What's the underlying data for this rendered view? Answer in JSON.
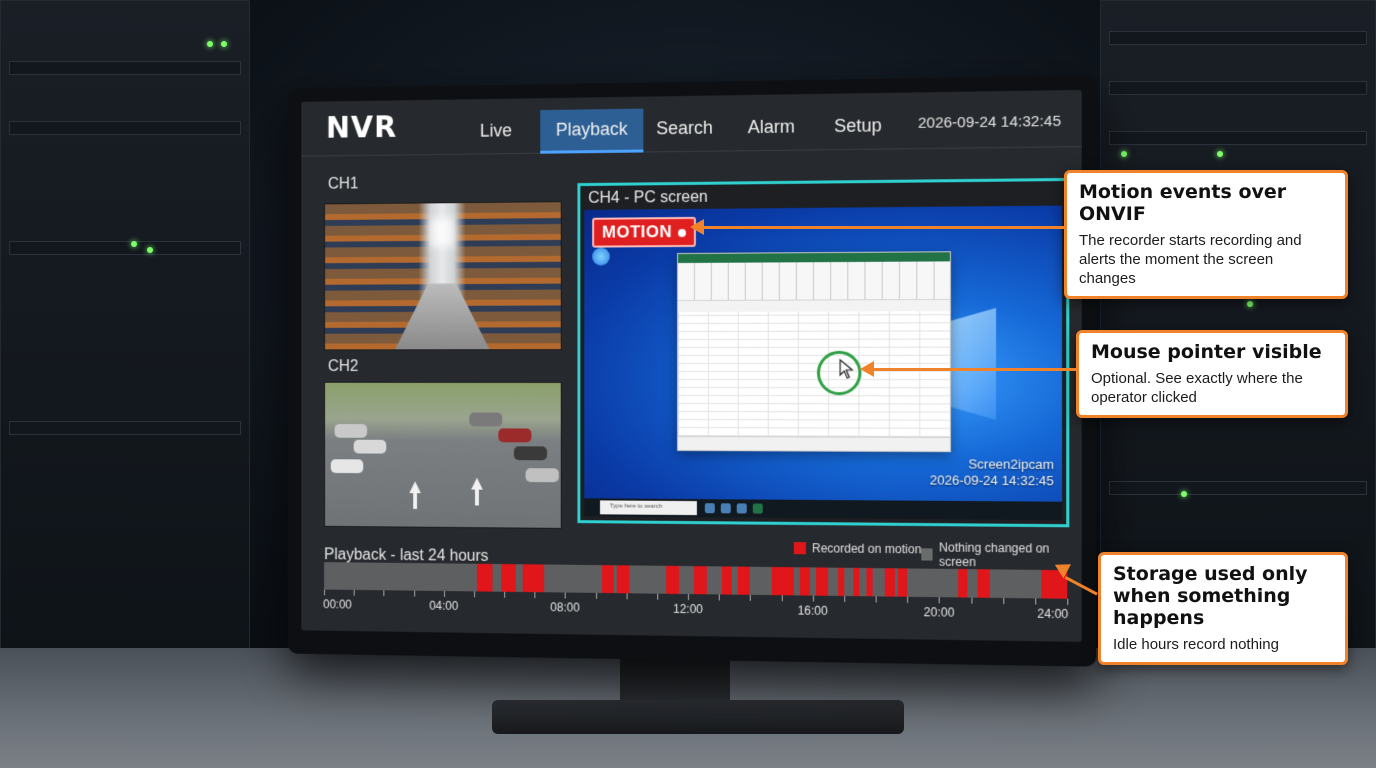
{
  "nvr": {
    "logo": "NVR",
    "tabs": [
      {
        "label": "Live",
        "active": false
      },
      {
        "label": "Playback",
        "active": true
      },
      {
        "label": "Search",
        "active": false
      },
      {
        "label": "Alarm",
        "active": false
      },
      {
        "label": "Setup",
        "active": false
      }
    ],
    "datetime": "2026-09-24 14:32:45"
  },
  "channels": {
    "ch1": {
      "label": "CH1"
    },
    "ch2": {
      "label": "CH2"
    },
    "ch4": {
      "label": "CH4 - PC screen",
      "motion_badge": "MOTION",
      "watermark_name": "Screen2ipcam",
      "watermark_time": "2026-09-24 14:32:45",
      "taskbar_search": "Type here to search"
    }
  },
  "playback": {
    "title": "Playback - last 24 hours",
    "legend_recorded": "Recorded on motion",
    "legend_nothing": "Nothing changed on screen",
    "colors": {
      "recorded": "#e0161b",
      "nothing": "#5e5f61"
    },
    "axis_labels": [
      "00:00",
      "04:00",
      "08:00",
      "12:00",
      "16:00",
      "20:00",
      "24:00"
    ],
    "recorded_segments_hours": [
      [
        5.1,
        5.6
      ],
      [
        5.9,
        6.4
      ],
      [
        6.6,
        7.3
      ],
      [
        9.2,
        9.6
      ],
      [
        9.7,
        10.1
      ],
      [
        11.3,
        11.7
      ],
      [
        12.2,
        12.6
      ],
      [
        13.1,
        13.4
      ],
      [
        13.6,
        14.0
      ],
      [
        14.7,
        15.4
      ],
      [
        15.6,
        15.9
      ],
      [
        16.1,
        16.5
      ],
      [
        16.8,
        17.0
      ],
      [
        17.3,
        17.5
      ],
      [
        17.7,
        17.9
      ],
      [
        18.3,
        18.6
      ],
      [
        18.7,
        19.0
      ],
      [
        20.6,
        20.9
      ],
      [
        21.2,
        21.6
      ],
      [
        23.2,
        24.0
      ]
    ]
  },
  "callouts": [
    {
      "title": "Motion events over ONVIF",
      "body": "The recorder starts recording and alerts the moment the screen changes"
    },
    {
      "title": "Mouse pointer visible",
      "body": "Optional. See exactly where the operator clicked"
    },
    {
      "title": "Storage used only when something happens",
      "body": "Idle hours record nothing"
    }
  ]
}
